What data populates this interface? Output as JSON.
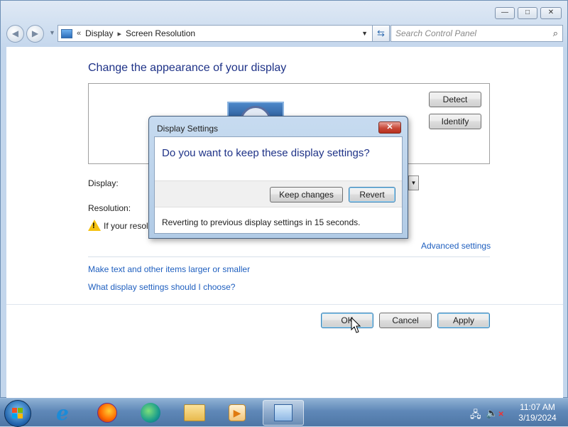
{
  "window": {
    "caption_buttons": {
      "minimize": "—",
      "maximize": "□",
      "close": "✕"
    },
    "address": {
      "separator": "«",
      "crumbs": [
        "Display",
        "Screen Resolution"
      ],
      "crumb_sep": "▸"
    },
    "search_placeholder": "Search Control Panel",
    "icons": [
      "back-icon",
      "forward-icon",
      "monitor-icon",
      "refresh-icon",
      "search-icon"
    ]
  },
  "main": {
    "title": "Change the appearance of your display",
    "detect_label": "Detect",
    "identify_label": "Identify",
    "display_label": "Display:",
    "resolution_label": "Resolution:",
    "warning_text": "If your resolu",
    "advanced_link": "Advanced settings",
    "links": [
      "Make text and other items larger or smaller",
      "What display settings should I choose?"
    ],
    "ok_label": "OK",
    "cancel_label": "Cancel",
    "apply_label": "Apply"
  },
  "dialog": {
    "title": "Display Settings",
    "question": "Do you want to keep these display settings?",
    "keep_label": "Keep changes",
    "revert_label": "Revert",
    "countdown_text": "Reverting to previous display settings in 15 seconds."
  },
  "taskbar": {
    "items": [
      "internet-explorer-icon",
      "firefox-icon",
      "edge-icon",
      "file-explorer-icon",
      "media-player-icon",
      "control-panel-icon"
    ],
    "clock_time": "11:07 AM",
    "clock_date": "3/19/2024"
  },
  "colors": {
    "title_blue": "#1e3287",
    "link_blue": "#1f5fbf",
    "close_red": "#c84a3a"
  }
}
